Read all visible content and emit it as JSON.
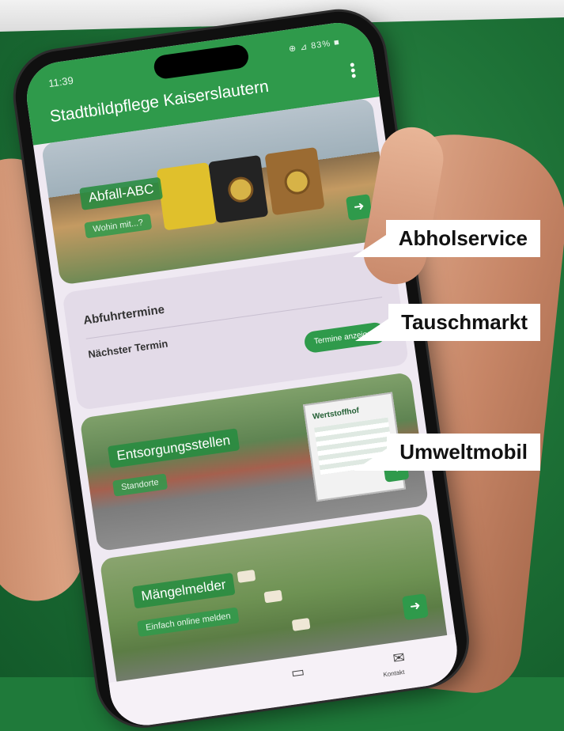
{
  "status_bar": {
    "time": "11:39",
    "icons": "⊕ ⊿ 83% ■"
  },
  "app": {
    "title": "Stadtbildpflege Kaiserslautern"
  },
  "cards": {
    "abfall": {
      "title": "Abfall-ABC",
      "subtitle": "Wohin mit...?"
    },
    "abfuhr": {
      "title": "Abfuhrtermine",
      "next_label": "Nächster Termin",
      "button": "Termine anzeigen"
    },
    "entsorgung": {
      "title": "Entsorgungsstellen",
      "subtitle": "Standorte",
      "sign": "Wertstoffhof"
    },
    "maengel": {
      "title": "Mängelmelder",
      "subtitle": "Einfach online melden"
    }
  },
  "bottom_nav": {
    "contact_label": "Kontakt"
  },
  "callouts": [
    "Abholservice",
    "Tauschmarkt",
    "Umweltmobil"
  ],
  "icons": {
    "arrow": "arrow-right-icon",
    "menu": "more-vert-icon",
    "calendar": "calendar-icon",
    "mail": "mail-icon"
  },
  "colors": {
    "brand_green": "#2f9a4b",
    "background_green": "#1f7a3a"
  }
}
